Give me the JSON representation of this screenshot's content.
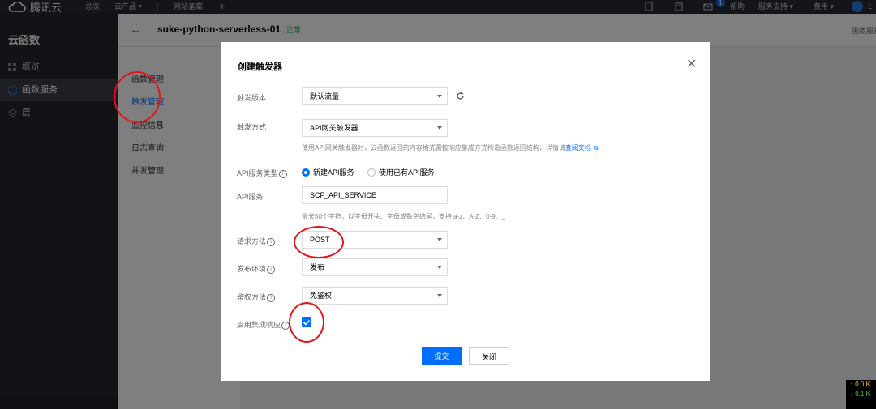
{
  "topbar": {
    "brand": "腾讯云",
    "nav": [
      "总览",
      "云产品 ▾",
      "网站备案"
    ],
    "right": [
      "帮助",
      "服务支持 ▾",
      "费用 ▾"
    ],
    "notification_count": "1",
    "user": "1"
  },
  "sidebar": {
    "title": "云函数",
    "items": [
      {
        "label": "概览",
        "icon": "grid-icon"
      },
      {
        "label": "函数服务",
        "icon": "function-icon"
      },
      {
        "label": "层",
        "icon": "layers-icon"
      }
    ]
  },
  "page": {
    "function_name": "suke-python-serverless-01",
    "status": "正常",
    "right_text": "函数服务"
  },
  "subnav": [
    "函数管理",
    "触发管理",
    "监控信息",
    "日志查询",
    "并发管理"
  ],
  "modal": {
    "title": "创建触发器",
    "fields": {
      "version": {
        "label": "触发版本",
        "value": "默认流量"
      },
      "method": {
        "label": "触发方式",
        "value": "API网关触发器",
        "hint": "使用API网关触发器时，云函数返回的内容格式需按响应集成方式构造函数返回结构，详情请",
        "hint_link": "查阅文档"
      },
      "api_type": {
        "label": "API服务类型",
        "options": [
          "新建API服务",
          "使用已有API服务"
        ]
      },
      "api_service": {
        "label": "API服务",
        "value": "SCF_API_SERVICE",
        "hint": "最长50个字符，以字母开头、字母或数字结尾，支持 a-z、A-Z、0-9、_"
      },
      "request_method": {
        "label": "请求方法",
        "value": "POST"
      },
      "environment": {
        "label": "发布环境",
        "value": "发布"
      },
      "auth": {
        "label": "鉴权方法",
        "value": "免鉴权"
      },
      "integration": {
        "label": "启用集成响应",
        "checked": true
      }
    },
    "submit_label": "提交",
    "close_label": "关闭"
  },
  "netspeed": {
    "up": "↑ 0.0 K",
    "down": "↓ 0.1 K"
  },
  "colors": {
    "accent": "#006eff",
    "annotation": "#e0171b",
    "topbar": "#272b33",
    "sidebar": "#22272e"
  }
}
